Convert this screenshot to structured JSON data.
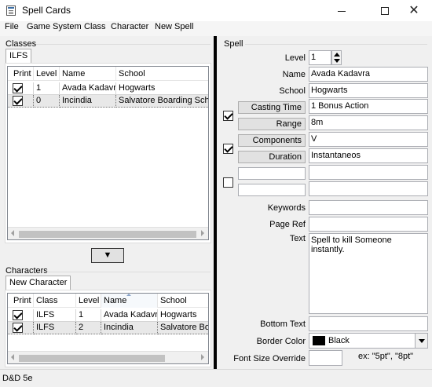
{
  "window": {
    "title": "Spell Cards",
    "minimize": "",
    "maximize": "",
    "close": "✕"
  },
  "menu": [
    "File",
    "Game System",
    "Class",
    "Character",
    "New Spell"
  ],
  "classes": {
    "group_label": "Classes",
    "tab": "ILFS",
    "columns": [
      "Print",
      "Level",
      "Name",
      "School"
    ],
    "rows": [
      {
        "print": true,
        "level": "1",
        "name": "Avada Kadavra",
        "school": "Hogwarts"
      },
      {
        "print": true,
        "level": "0",
        "name": "Incindia",
        "school": "Salvatore Boarding School"
      }
    ]
  },
  "down_button": "▼",
  "characters": {
    "group_label": "Characters",
    "tab": "New Character",
    "columns": [
      "Print",
      "Class",
      "Level",
      "Name",
      "School"
    ],
    "rows": [
      {
        "print": true,
        "class": "ILFS",
        "level": "1",
        "name": "Avada Kadavra",
        "school": "Hogwarts"
      },
      {
        "print": true,
        "class": "ILFS",
        "level": "2",
        "name": "Incindia",
        "school": "Salvatore Boarding"
      }
    ]
  },
  "spell": {
    "group_label": "Spell",
    "level_label": "Level",
    "level_value": "1",
    "name_label": "Name",
    "name_value": "Avada Kadavra",
    "school_label": "School",
    "school_value": "Hogwarts",
    "casting_time_label": "Casting Time",
    "casting_time_value": "1 Bonus Action",
    "range_label": "Range",
    "range_value": "8m",
    "components_label": "Components",
    "components_value": "V",
    "duration_label": "Duration",
    "duration_value": "Instantaneos",
    "custom1_label": "",
    "custom1_value": "",
    "custom2_label": "",
    "custom2_value": "",
    "keywords_label": "Keywords",
    "keywords_value": "",
    "page_ref_label": "Page Ref",
    "page_ref_value": "",
    "text_label": "Text",
    "text_value": "Spell to kill Someone instantly.",
    "bottom_text_label": "Bottom Text",
    "bottom_text_value": "",
    "border_color_label": "Border Color",
    "border_color_value": "Black",
    "border_color_swatch": "#000000",
    "font_size_label": "Font Size Override",
    "font_size_value": "",
    "font_size_hint": "ex: \"5pt\", \"8pt\"",
    "casting_print": true,
    "components_print": true,
    "custom_print": false
  },
  "status": "D&D 5e"
}
